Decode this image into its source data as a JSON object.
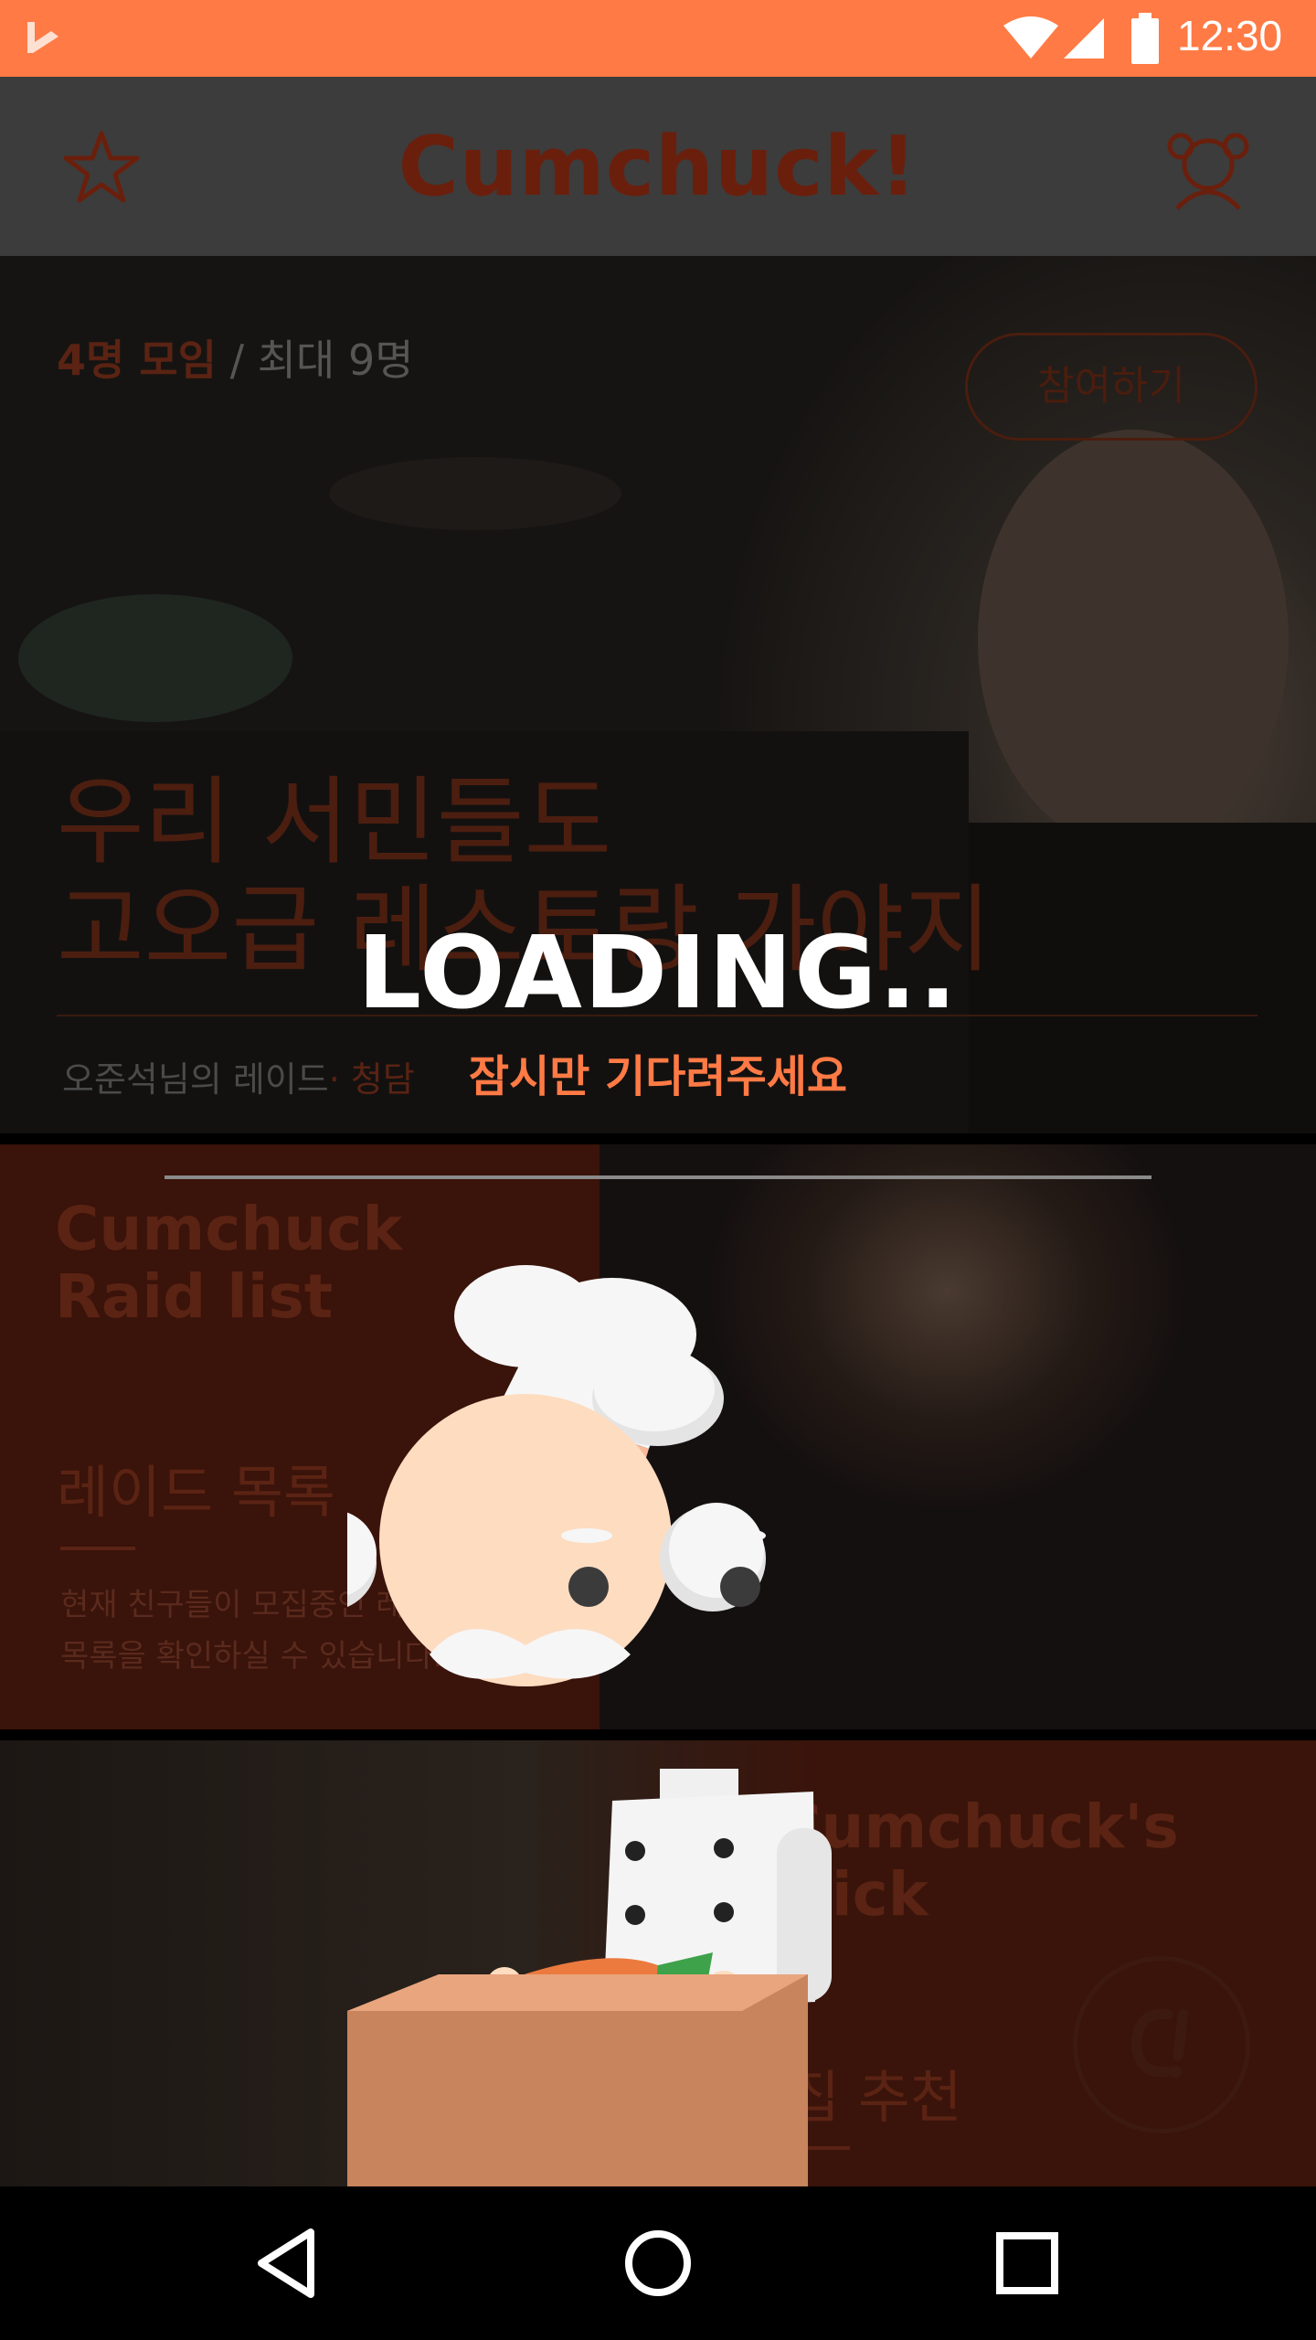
{
  "status_bar": {
    "time": "12:30"
  },
  "header": {
    "app_name": "Cumchuck!"
  },
  "hero": {
    "count_current": "4명 모임",
    "count_max": " / 최대 9명",
    "join_label": "참여하기",
    "title_line1": "우리 서민들도",
    "title_line2": "고오급 레스토랑 가야지",
    "meta_host": "오준석님의 레이드",
    "meta_location": "· 청담 "
  },
  "raid_list": {
    "heading_line1": "Cumchuck",
    "heading_line2": "Raid list",
    "subtitle": "레이드 목록",
    "desc_line1": "현재 친구들이 모집중인 레이",
    "desc_line2": "목록을 확인하실 수 있습니다."
  },
  "pick": {
    "heading_line1": "Cumchuck's",
    "heading_line2": "ick",
    "subtitle": "집 추천"
  },
  "loading": {
    "title": "LOADING..",
    "subtitle": "잠시만 기다려주세요"
  },
  "colors": {
    "accent": "#ff7a45",
    "header_bg": "#3c3c3c",
    "dim_brown": "#5a2313"
  },
  "icons": {
    "status": [
      "app-logo-icon",
      "wifi-icon",
      "signal-icon",
      "battery-icon"
    ],
    "header": [
      "star-icon",
      "profile-icon"
    ],
    "nav": [
      "back-icon",
      "home-icon",
      "recents-icon"
    ]
  }
}
